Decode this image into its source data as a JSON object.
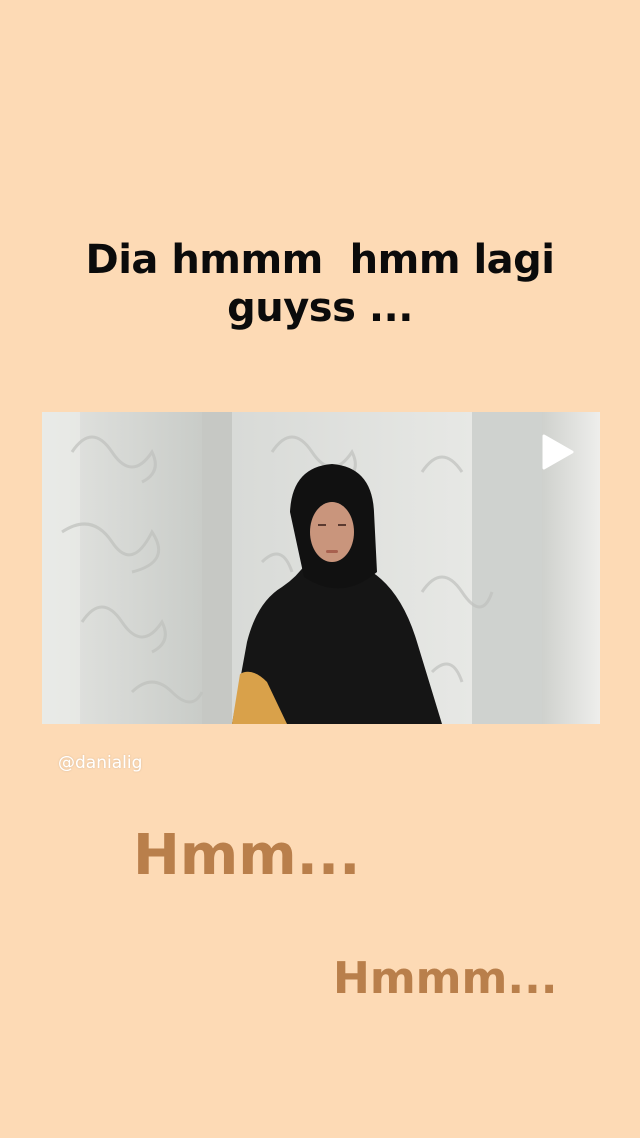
{
  "story": {
    "headline_lines": [
      "Dia hmmm  hmm lagi",
      "guyss ..."
    ],
    "media": {
      "play_icon": "play-icon"
    },
    "mention": "@danialig",
    "sticker_1": "Hmm...",
    "sticker_2": "Hmmm..."
  },
  "colors": {
    "background": "#fddab5",
    "headline": "#0b0b0b",
    "sticker_text": "#b97f4b",
    "mention_text": "#ffffff"
  }
}
